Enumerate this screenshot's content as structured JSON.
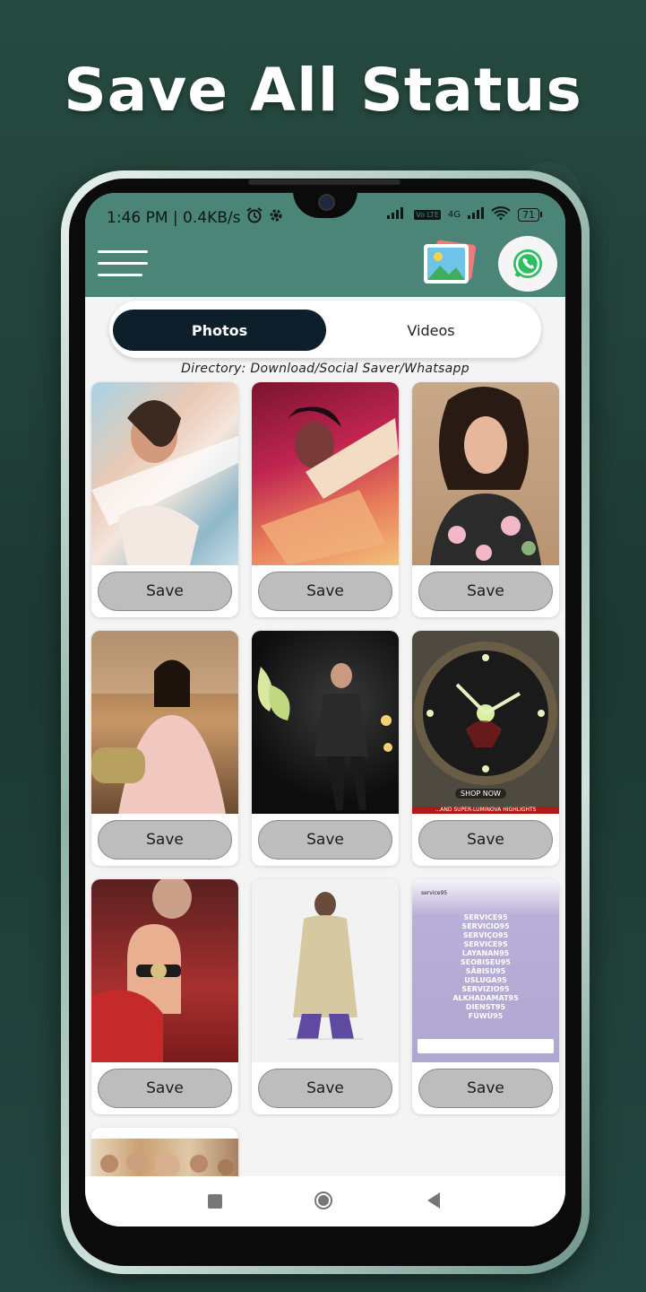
{
  "headline": "Save All Status",
  "status_bar": {
    "time_speed": "1:46 PM | 0.4KB/s",
    "network": "4G",
    "volte": "Vo LTE",
    "battery": "71"
  },
  "tabs": [
    {
      "label": "Photos",
      "active": true
    },
    {
      "label": "Videos",
      "active": false
    }
  ],
  "directory": "Directory: Download/Social Saver/Whatsapp",
  "cards": [
    {
      "save_label": "Save",
      "thumb": "woman in car photo"
    },
    {
      "save_label": "Save",
      "thumb": "woman in pink light photo"
    },
    {
      "save_label": "Save",
      "thumb": "woman floral dress portrait"
    },
    {
      "save_label": "Save",
      "thumb": "woman seated on sofa photo"
    },
    {
      "save_label": "Save",
      "thumb": "man on stage photo"
    },
    {
      "save_label": "Save",
      "thumb": "citizen watch ad",
      "caption": "...AND SUPER-LUMINOVA HIGHLIGHTS",
      "shop": "SHOP NOW"
    },
    {
      "save_label": "Save",
      "thumb": "man with watch photo"
    },
    {
      "save_label": "Save",
      "thumb": "person in coat photo"
    },
    {
      "save_label": "Save",
      "thumb": "service95 post",
      "header": "service95",
      "lines": [
        "SERVICE95",
        "SERVICIO95",
        "SERVIÇO95",
        "SERVICE95",
        "LAYANAN95",
        "SEOBISEU95",
        "SĀBISU95",
        "USLUGA95",
        "SERVIZIO95",
        "ALKHADAMAT95",
        "DIENST95",
        "FÚWÙ95"
      ]
    }
  ],
  "colors": {
    "app_bar": "#4a8577",
    "active_tab": "#0d1f2b",
    "save_button": "#bdbdbd"
  }
}
